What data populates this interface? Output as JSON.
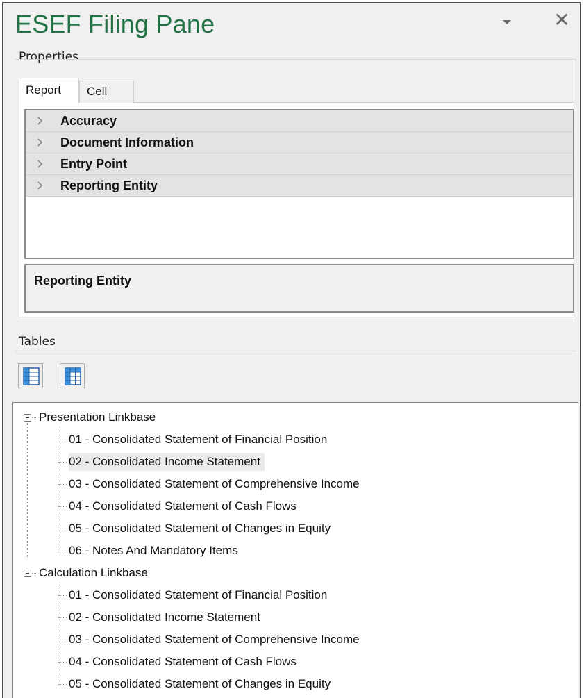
{
  "pane": {
    "title": "ESEF Filing Pane",
    "menu_icon": "dropdown-triangle-icon",
    "close_label": "✕"
  },
  "properties": {
    "label": "Properties",
    "tabs": [
      {
        "label": "Report",
        "active": true
      },
      {
        "label": "Cell",
        "active": false
      }
    ],
    "categories": [
      {
        "label": "Accuracy"
      },
      {
        "label": "Document Information"
      },
      {
        "label": "Entry Point"
      },
      {
        "label": "Reporting Entity"
      }
    ],
    "description_title": "Reporting Entity"
  },
  "tables": {
    "label": "Tables",
    "toolbar": [
      {
        "icon": "table-rows-icon"
      },
      {
        "icon": "table-grid-icon"
      }
    ],
    "tree": [
      {
        "label": "Presentation Linkbase",
        "expanded": true,
        "children": [
          {
            "label": "01 - Consolidated Statement of Financial Position"
          },
          {
            "label": "02 - Consolidated Income Statement",
            "selected": true
          },
          {
            "label": "03 - Consolidated Statement of Comprehensive Income"
          },
          {
            "label": "04 - Consolidated Statement of Cash Flows"
          },
          {
            "label": "05 - Consolidated Statement of Changes in Equity"
          },
          {
            "label": "06 - Notes And Mandatory Items"
          }
        ]
      },
      {
        "label": "Calculation Linkbase",
        "expanded": true,
        "children": [
          {
            "label": "01 - Consolidated Statement of Financial Position"
          },
          {
            "label": "02 - Consolidated Income Statement"
          },
          {
            "label": "03 - Consolidated Statement of Comprehensive Income"
          },
          {
            "label": "04 - Consolidated Statement of Cash Flows"
          },
          {
            "label": "05 - Consolidated Statement of Changes in Equity"
          }
        ]
      }
    ]
  }
}
